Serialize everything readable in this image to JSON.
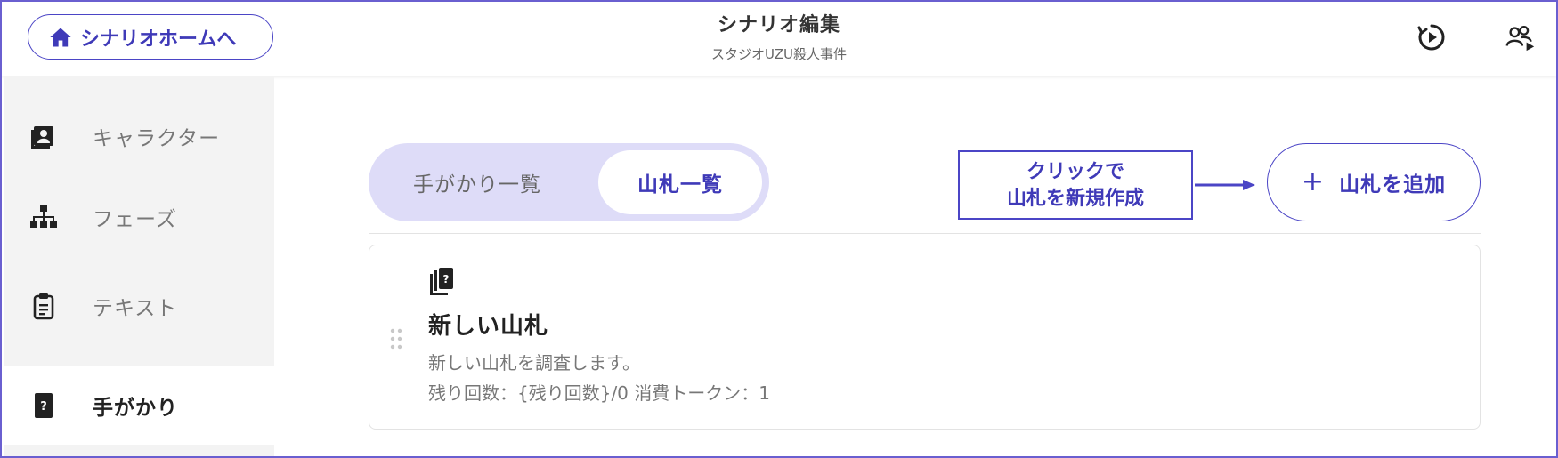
{
  "header": {
    "home_label": "シナリオホームへ",
    "title": "シナリオ編集",
    "subtitle": "スタジオUZU殺人事件"
  },
  "sidebar": {
    "items": [
      {
        "label": "キャラクター",
        "icon": "character-icon"
      },
      {
        "label": "フェーズ",
        "icon": "hierarchy-icon"
      },
      {
        "label": "テキスト",
        "icon": "clipboard-icon"
      },
      {
        "label": "手がかり",
        "icon": "clue-card-icon",
        "active": true
      }
    ]
  },
  "tabs": [
    {
      "label": "手がかり一覧",
      "selected": false
    },
    {
      "label": "山札一覧",
      "selected": true
    }
  ],
  "callout": {
    "line1": "クリックで",
    "line2": "山札を新規作成"
  },
  "add_button": {
    "label": "山札を追加"
  },
  "deck_card": {
    "title": "新しい山札",
    "description": "新しい山札を調査します。",
    "meta": "残り回数：{残り回数}/0 消費トークン：1"
  },
  "colors": {
    "accent": "#3f3ab8",
    "tab_track": "#dedcf8",
    "sidebar_bg": "#f3f3f3"
  }
}
